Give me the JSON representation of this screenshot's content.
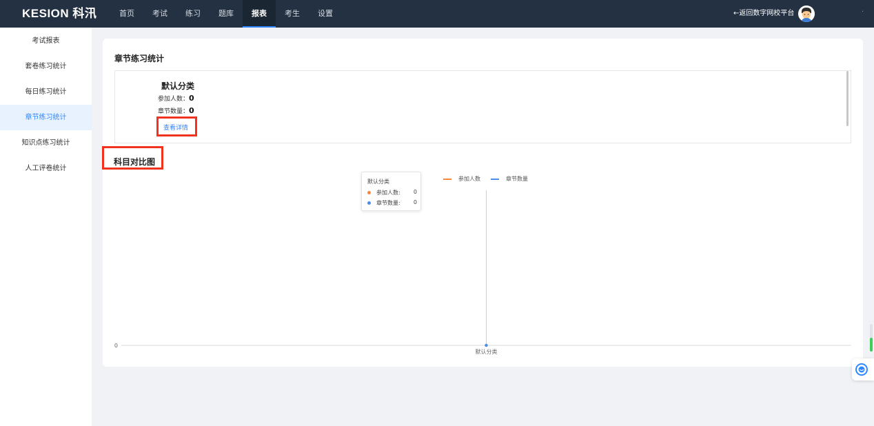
{
  "app": {
    "logo": "KESION 科汛"
  },
  "nav": {
    "items": [
      {
        "label": "首页",
        "active": false
      },
      {
        "label": "考试",
        "active": false
      },
      {
        "label": "练习",
        "active": false
      },
      {
        "label": "题库",
        "active": false
      },
      {
        "label": "报表",
        "active": true
      },
      {
        "label": "考生",
        "active": false
      },
      {
        "label": "设置",
        "active": false
      }
    ],
    "back_link": "←返回数字网校平台",
    "avatar_icon": "user-avatar-icon",
    "more": "·"
  },
  "sidebar": {
    "items": [
      {
        "label": "考试报表",
        "active": false
      },
      {
        "label": "套卷练习统计",
        "active": false
      },
      {
        "label": "每日练习统计",
        "active": false
      },
      {
        "label": "章节练习统计",
        "active": true
      },
      {
        "label": "知识点练习统计",
        "active": false
      },
      {
        "label": "人工评卷统计",
        "active": false
      }
    ]
  },
  "main": {
    "section_title": "章节练习统计",
    "category": {
      "title": "默认分类",
      "participants_label": "参加人数：",
      "participants_value": "0",
      "chapters_label": "章节数量：",
      "chapters_value": "0",
      "detail_link": "查看详情"
    },
    "chart_title": "科目对比图"
  },
  "chart_data": {
    "type": "line",
    "categories": [
      "默认分类"
    ],
    "series": [
      {
        "name": "参加人数",
        "values": [
          0
        ],
        "color": "#f5863a"
      },
      {
        "name": "章节数量",
        "values": [
          0
        ],
        "color": "#4b8ee8"
      }
    ],
    "yticks": [
      "0"
    ],
    "legend_position": "top",
    "tooltip": {
      "title": "默认分类",
      "rows": [
        {
          "label": "参加人数:",
          "value": "0"
        },
        {
          "label": "章节数量:",
          "value": "0"
        }
      ]
    }
  },
  "colors": {
    "accent": "#2f88ff",
    "highlight": "#f0321e",
    "topbar": "#233142"
  }
}
